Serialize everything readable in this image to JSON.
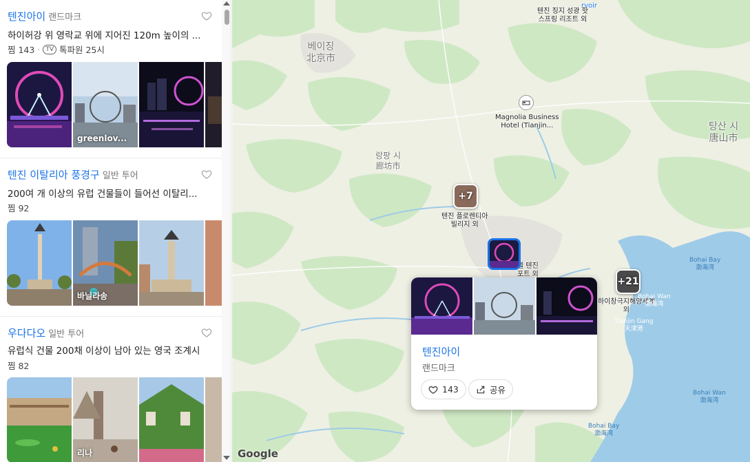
{
  "colors": {
    "accent": "#1a73e8",
    "water": "#9ecbe8",
    "green": "#cfe8c4"
  },
  "list": {
    "items": [
      {
        "title": "텐진아이",
        "category": "랜드마크",
        "description": "하이허강 위 영락교 위에 지어진 120m 높이의 ...",
        "likes_label": "찜 143",
        "tv_badge": "TV",
        "tv_source": "톡파원 25시",
        "photo_labels": [
          "",
          "greenlov...",
          "",
          ""
        ]
      },
      {
        "title": "텐진 이탈리아 풍경구",
        "category": "일반 투어",
        "description": "200여 개 이상의 유럽 건물들이 들어선 이탈리...",
        "likes_label": "찜 92",
        "photo_labels": [
          "",
          "바닐라송",
          "",
          ""
        ]
      },
      {
        "title": "우다다오",
        "category": "일반 투어",
        "description": "유럽식 건물 200채 이상이 남아 있는 영국 조계시",
        "likes_label": "찜 82",
        "photo_labels": [
          "",
          "리나",
          "",
          ""
        ]
      }
    ]
  },
  "map": {
    "cities": [
      {
        "ko": "베이징",
        "zh": "北京市"
      },
      {
        "ko": "랑팡 시",
        "zh": "廊坊市"
      },
      {
        "ko": "탕산 시",
        "zh": "唐山市"
      }
    ],
    "pois": [
      {
        "label_1": "텐진 징지 성광 핫",
        "label_2": "스프링 리조트 외"
      },
      {
        "label_1": "Magnolia Business",
        "label_2": "Hotel (Tianjin..."
      },
      {
        "label_1": "텐진 플로렌티아",
        "label_2": "빌리지 외"
      },
      {
        "label_1": "텔 텐진",
        "label_2": "포트 외"
      },
      {
        "label_1": "하이창극지해양세계",
        "label_2": "외"
      }
    ],
    "clusters": [
      {
        "count": "+7"
      },
      {
        "count": "+21"
      }
    ],
    "water_labels": [
      {
        "en": "Bohai Bay",
        "zh": "渤海湾"
      },
      {
        "en": "Bohai Wan",
        "zh": "渤海湾"
      },
      {
        "en": "Tianjin Gang",
        "zh": "天津港"
      },
      {
        "en": "Bohai Wan",
        "zh": "渤海湾"
      },
      {
        "en": "Bohai Bay",
        "zh": "渤海湾"
      }
    ],
    "reservoir_fragment": "rvoir",
    "google_logo": "Google"
  },
  "card": {
    "title": "텐진아이",
    "category": "랜드마크",
    "like_count": "143",
    "share_label": "공유"
  }
}
